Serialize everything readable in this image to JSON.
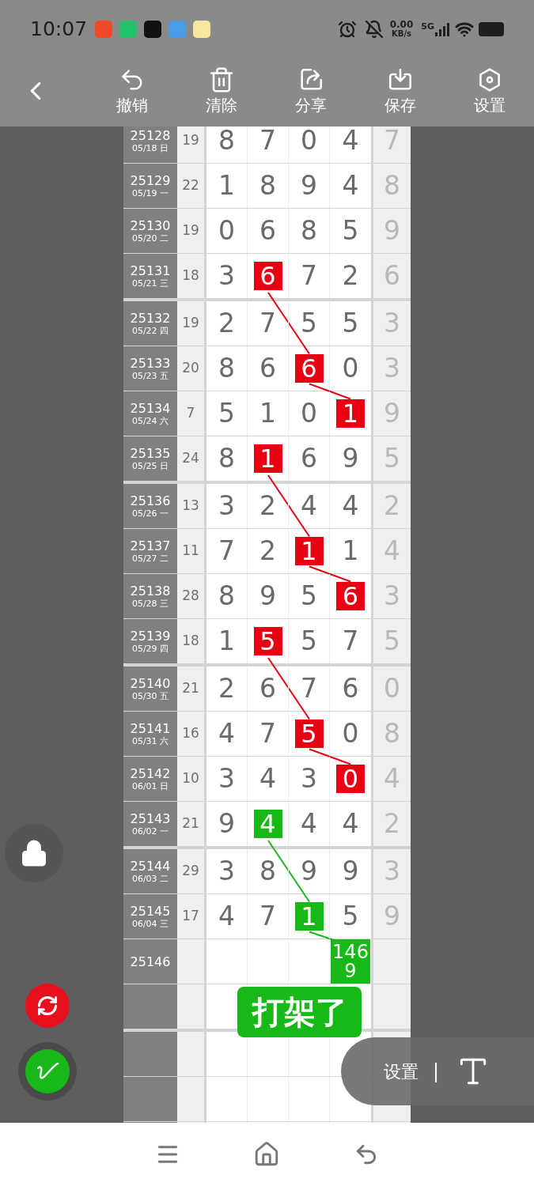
{
  "status_bar": {
    "time": "10:07",
    "apps": [
      {
        "color": "#f04a2a"
      },
      {
        "color": "#1fc16b"
      },
      {
        "color": "#111111"
      },
      {
        "color": "#4a9de8"
      },
      {
        "color": "#f6e7a0"
      }
    ],
    "speed": "0.00",
    "speed_unit": "KB/s",
    "network": "5G"
  },
  "toolbar": {
    "actions": [
      {
        "kind": "undo",
        "label": "撤销"
      },
      {
        "kind": "clear",
        "label": "清除"
      },
      {
        "kind": "share",
        "label": "分享"
      },
      {
        "kind": "save",
        "label": "保存"
      },
      {
        "kind": "settings",
        "label": "设置"
      }
    ]
  },
  "table": {
    "rows": [
      {
        "period": "25128",
        "date": "05/18 日",
        "sum": "19",
        "digits": [
          {
            "value": "8"
          },
          {
            "value": "7"
          },
          {
            "value": "0"
          },
          {
            "value": "4"
          }
        ],
        "span": "7"
      },
      {
        "period": "25129",
        "date": "05/19 一",
        "sum": "22",
        "digits": [
          {
            "value": "1"
          },
          {
            "value": "8"
          },
          {
            "value": "9"
          },
          {
            "value": "4"
          }
        ],
        "span": "8"
      },
      {
        "period": "25130",
        "date": "05/20 二",
        "sum": "19",
        "digits": [
          {
            "value": "0"
          },
          {
            "value": "6"
          },
          {
            "value": "8"
          },
          {
            "value": "5"
          }
        ],
        "span": "9"
      },
      {
        "period": "25131",
        "date": "05/21 三",
        "sum": "18",
        "digits": [
          {
            "value": "3"
          },
          {
            "value": "6",
            "color": "#e60012"
          },
          {
            "value": "7"
          },
          {
            "value": "2"
          }
        ],
        "span": "6"
      },
      {
        "period": "25132",
        "date": "05/22 四",
        "sum": "19",
        "digits": [
          {
            "value": "2"
          },
          {
            "value": "7"
          },
          {
            "value": "5"
          },
          {
            "value": "5"
          }
        ],
        "span": "3"
      },
      {
        "period": "25133",
        "date": "05/23 五",
        "sum": "20",
        "digits": [
          {
            "value": "8"
          },
          {
            "value": "6"
          },
          {
            "value": "6",
            "color": "#e60012"
          },
          {
            "value": "0"
          }
        ],
        "span": "3"
      },
      {
        "period": "25134",
        "date": "05/24 六",
        "sum": "7",
        "digits": [
          {
            "value": "5"
          },
          {
            "value": "1"
          },
          {
            "value": "0"
          },
          {
            "value": "1",
            "color": "#e60012"
          }
        ],
        "span": "9"
      },
      {
        "period": "25135",
        "date": "05/25 日",
        "sum": "24",
        "digits": [
          {
            "value": "8"
          },
          {
            "value": "1",
            "color": "#e60012"
          },
          {
            "value": "6"
          },
          {
            "value": "9"
          }
        ],
        "span": "5"
      },
      {
        "period": "25136",
        "date": "05/26 一",
        "sum": "13",
        "digits": [
          {
            "value": "3"
          },
          {
            "value": "2"
          },
          {
            "value": "4"
          },
          {
            "value": "4"
          }
        ],
        "span": "2"
      },
      {
        "period": "25137",
        "date": "05/27 二",
        "sum": "11",
        "digits": [
          {
            "value": "7"
          },
          {
            "value": "2"
          },
          {
            "value": "1",
            "color": "#e60012"
          },
          {
            "value": "1"
          }
        ],
        "span": "4"
      },
      {
        "period": "25138",
        "date": "05/28 三",
        "sum": "28",
        "digits": [
          {
            "value": "8"
          },
          {
            "value": "9"
          },
          {
            "value": "5"
          },
          {
            "value": "6",
            "color": "#e60012"
          }
        ],
        "span": "3"
      },
      {
        "period": "25139",
        "date": "05/29 四",
        "sum": "18",
        "digits": [
          {
            "value": "1"
          },
          {
            "value": "5",
            "color": "#e60012"
          },
          {
            "value": "5"
          },
          {
            "value": "7"
          }
        ],
        "span": "5"
      },
      {
        "period": "25140",
        "date": "05/30 五",
        "sum": "21",
        "digits": [
          {
            "value": "2"
          },
          {
            "value": "6"
          },
          {
            "value": "7"
          },
          {
            "value": "6"
          }
        ],
        "span": "0"
      },
      {
        "period": "25141",
        "date": "05/31 六",
        "sum": "16",
        "digits": [
          {
            "value": "4"
          },
          {
            "value": "7"
          },
          {
            "value": "5",
            "color": "#e60012"
          },
          {
            "value": "0"
          }
        ],
        "span": "8"
      },
      {
        "period": "25142",
        "date": "06/01 日",
        "sum": "10",
        "digits": [
          {
            "value": "3"
          },
          {
            "value": "4"
          },
          {
            "value": "3"
          },
          {
            "value": "0",
            "color": "#e60012"
          }
        ],
        "span": "4"
      },
      {
        "period": "25143",
        "date": "06/02 一",
        "sum": "21",
        "digits": [
          {
            "value": "9"
          },
          {
            "value": "4",
            "color": "#18b818"
          },
          {
            "value": "4"
          },
          {
            "value": "4"
          }
        ],
        "span": "2"
      },
      {
        "period": "25144",
        "date": "06/03 二",
        "sum": "29",
        "digits": [
          {
            "value": "3"
          },
          {
            "value": "8"
          },
          {
            "value": "9"
          },
          {
            "value": "9"
          }
        ],
        "span": "3"
      },
      {
        "period": "25145",
        "date": "06/04 三",
        "sum": "17",
        "digits": [
          {
            "value": "4"
          },
          {
            "value": "7"
          },
          {
            "value": "1",
            "color": "#18b818"
          },
          {
            "value": "5"
          }
        ],
        "span": "9"
      },
      {
        "period": "25146",
        "forecast": {
          "value": "1469",
          "color": "#18b818"
        }
      }
    ]
  },
  "tag": "打架了",
  "settings_pill": {
    "label": "设置",
    "divider": "|"
  }
}
